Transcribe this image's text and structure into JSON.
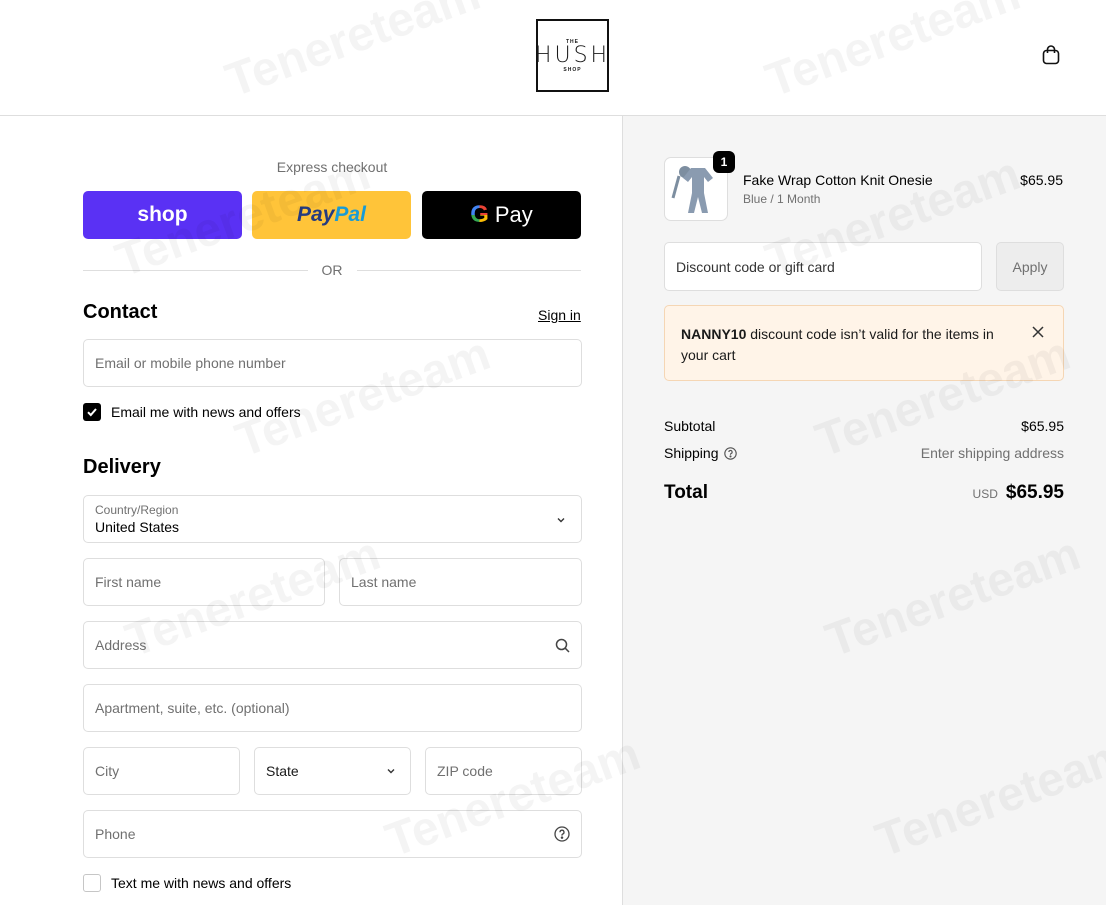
{
  "header": {
    "logo": {
      "top": "THE",
      "main": "HUSH",
      "bottom": "SHOP"
    },
    "cart_icon": "shopping-bag-icon"
  },
  "express": {
    "title": "Express checkout",
    "shop_label": "shop",
    "paypal_label_1": "Pay",
    "paypal_label_2": "Pal",
    "gpay_g": "G",
    "gpay_label": "Pay",
    "or_label": "OR"
  },
  "contact": {
    "title": "Contact",
    "sign_in": "Sign in",
    "email_placeholder": "Email or mobile phone number",
    "news_label": "Email me with news and offers",
    "news_checked": true
  },
  "delivery": {
    "title": "Delivery",
    "country_label": "Country/Region",
    "country_value": "United States",
    "first_name": "First name",
    "last_name": "Last name",
    "address": "Address",
    "apartment": "Apartment, suite, etc. (optional)",
    "city": "City",
    "state": "State",
    "zip": "ZIP code",
    "phone": "Phone",
    "text_label": "Text me with news and offers",
    "text_checked": false
  },
  "summary": {
    "item": {
      "quantity": "1",
      "name": "Fake Wrap Cotton Knit Onesie",
      "variant": "Blue / 1 Month",
      "price": "$65.95"
    },
    "discount_placeholder": "Discount code or gift card",
    "apply_label": "Apply",
    "alert": {
      "code": "NANNY10",
      "message": " discount code isn’t valid for the items in your cart"
    },
    "subtotal_label": "Subtotal",
    "subtotal_value": "$65.95",
    "shipping_label": "Shipping",
    "shipping_value": "Enter shipping address",
    "total_label": "Total",
    "currency": "USD",
    "total_value": "$65.95"
  },
  "watermark_text": "Tenereteam",
  "colors": {
    "shop_purple": "#5a31f4",
    "paypal_yellow": "#ffc439",
    "gpay_black": "#000000",
    "alert_bg": "#fff4e8",
    "summary_bg": "#f5f5f5"
  }
}
